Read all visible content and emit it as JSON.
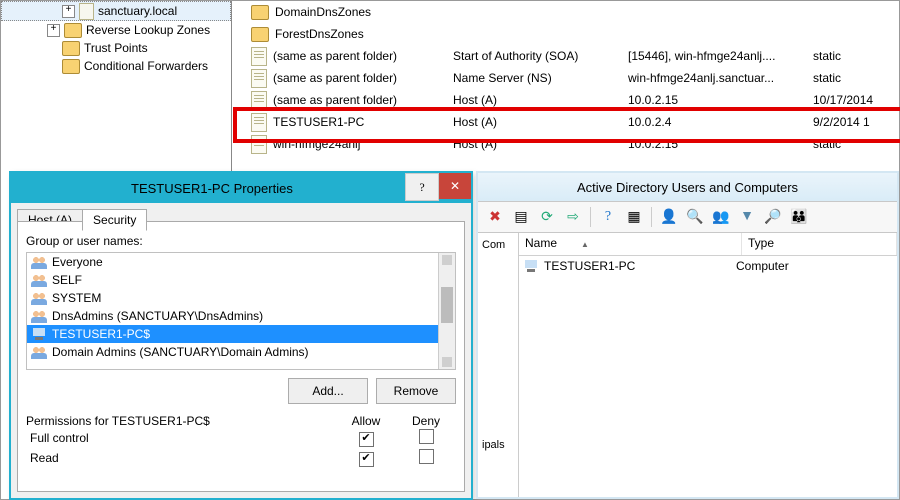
{
  "dns_tree": {
    "items": [
      {
        "label": "sanctuary.local",
        "icon": "db",
        "expandable": true
      },
      {
        "label": "Reverse Lookup Zones",
        "icon": "folder",
        "expandable": true
      },
      {
        "label": "Trust Points",
        "icon": "folder",
        "expandable": true
      },
      {
        "label": "Conditional Forwarders",
        "icon": "folder",
        "expandable": true
      }
    ]
  },
  "dns_records": {
    "rows": [
      {
        "name": "DomainDnsZones",
        "type": "",
        "data": "",
        "ts": "",
        "icon": "folder"
      },
      {
        "name": "ForestDnsZones",
        "type": "",
        "data": "",
        "ts": "",
        "icon": "folder"
      },
      {
        "name": "(same as parent folder)",
        "type": "Start of Authority (SOA)",
        "data": "[15446], win-hfmge24anlj....",
        "ts": "static",
        "icon": "rec"
      },
      {
        "name": "(same as parent folder)",
        "type": "Name Server (NS)",
        "data": "win-hfmge24anlj.sanctuar...",
        "ts": "static",
        "icon": "rec"
      },
      {
        "name": "(same as parent folder)",
        "type": "Host (A)",
        "data": "10.0.2.15",
        "ts": "10/17/2014",
        "icon": "rec"
      },
      {
        "name": "TESTUSER1-PC",
        "type": "Host (A)",
        "data": "10.0.2.4",
        "ts": "9/2/2014 1",
        "icon": "rec",
        "highlight": true
      },
      {
        "name": "win-hfmge24anlj",
        "type": "Host (A)",
        "data": "10.0.2.15",
        "ts": "static",
        "icon": "rec"
      }
    ]
  },
  "dialog": {
    "title": "TESTUSER1-PC Properties",
    "tabs": [
      {
        "label": "Host (A)",
        "active": false
      },
      {
        "label": "Security",
        "active": true
      }
    ],
    "group_label": "Group or user names:",
    "principals": [
      {
        "name": "Everyone",
        "icon": "grp"
      },
      {
        "name": "SELF",
        "icon": "grp"
      },
      {
        "name": "SYSTEM",
        "icon": "grp"
      },
      {
        "name": "DnsAdmins (SANCTUARY\\DnsAdmins)",
        "icon": "grp"
      },
      {
        "name": "TESTUSER1-PC$",
        "icon": "pc",
        "selected": true
      },
      {
        "name": "Domain Admins (SANCTUARY\\Domain Admins)",
        "icon": "grp"
      }
    ],
    "add_btn": "Add...",
    "remove_btn": "Remove",
    "perm_for_label": "Permissions for TESTUSER1-PC$",
    "allow_hdr": "Allow",
    "deny_hdr": "Deny",
    "perms": [
      {
        "name": "Full control",
        "allow": true,
        "deny": false
      },
      {
        "name": "Read",
        "allow": true,
        "deny": false
      }
    ]
  },
  "aduc": {
    "title": "Active Directory Users and Computers",
    "tree_fragments": [
      "Com",
      "ipals"
    ],
    "columns": {
      "c1": "Name",
      "c2": "Type"
    },
    "rows": [
      {
        "name": "TESTUSER1-PC",
        "type": "Computer"
      }
    ]
  }
}
